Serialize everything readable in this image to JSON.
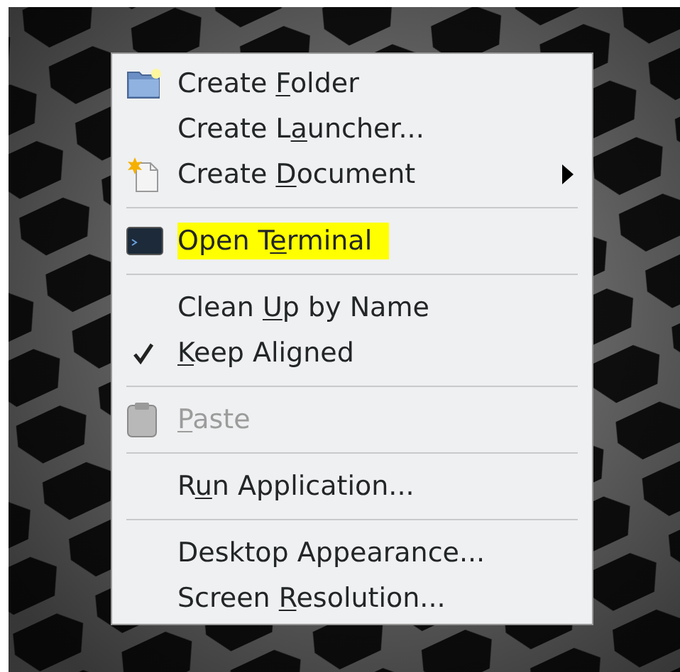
{
  "menu": {
    "items": [
      {
        "kind": "item",
        "before": "Create ",
        "key": "F",
        "after": "older",
        "disabled": false,
        "highlighted": false,
        "submenu": false
      },
      {
        "kind": "item",
        "before": "Create L",
        "key": "a",
        "after": "uncher...",
        "disabled": false,
        "highlighted": false,
        "submenu": false
      },
      {
        "kind": "item",
        "before": "Create ",
        "key": "D",
        "after": "ocument",
        "disabled": false,
        "highlighted": false,
        "submenu": true
      },
      {
        "kind": "separator"
      },
      {
        "kind": "item",
        "before": "Open T",
        "key": "e",
        "after": "rminal",
        "disabled": false,
        "highlighted": true,
        "submenu": false
      },
      {
        "kind": "separator"
      },
      {
        "kind": "item",
        "before": "Clean ",
        "key": "U",
        "after": "p by Name",
        "disabled": false,
        "highlighted": false,
        "submenu": false
      },
      {
        "kind": "check",
        "key": "K",
        "after": "eep Aligned",
        "checked": true,
        "disabled": false,
        "highlighted": false,
        "submenu": false
      },
      {
        "kind": "separator"
      },
      {
        "kind": "item",
        "key": "P",
        "after": "aste",
        "disabled": true,
        "highlighted": false,
        "submenu": false
      },
      {
        "kind": "separator"
      },
      {
        "kind": "item",
        "before": "R",
        "key": "u",
        "after": "n Application...",
        "disabled": false,
        "highlighted": false,
        "submenu": false
      },
      {
        "kind": "separator"
      },
      {
        "kind": "item",
        "before": "Desktop Appearance...",
        "disabled": false,
        "highlighted": false,
        "submenu": false
      },
      {
        "kind": "item",
        "before": "Screen ",
        "key": "R",
        "after": "esolution...",
        "disabled": false,
        "highlighted": false,
        "submenu": false
      }
    ]
  }
}
